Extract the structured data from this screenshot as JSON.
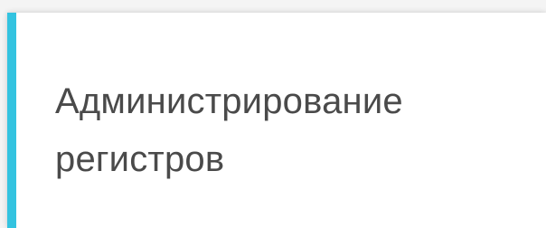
{
  "card": {
    "title": "Администрирование регистров",
    "accent_color": "#33c3e0"
  }
}
